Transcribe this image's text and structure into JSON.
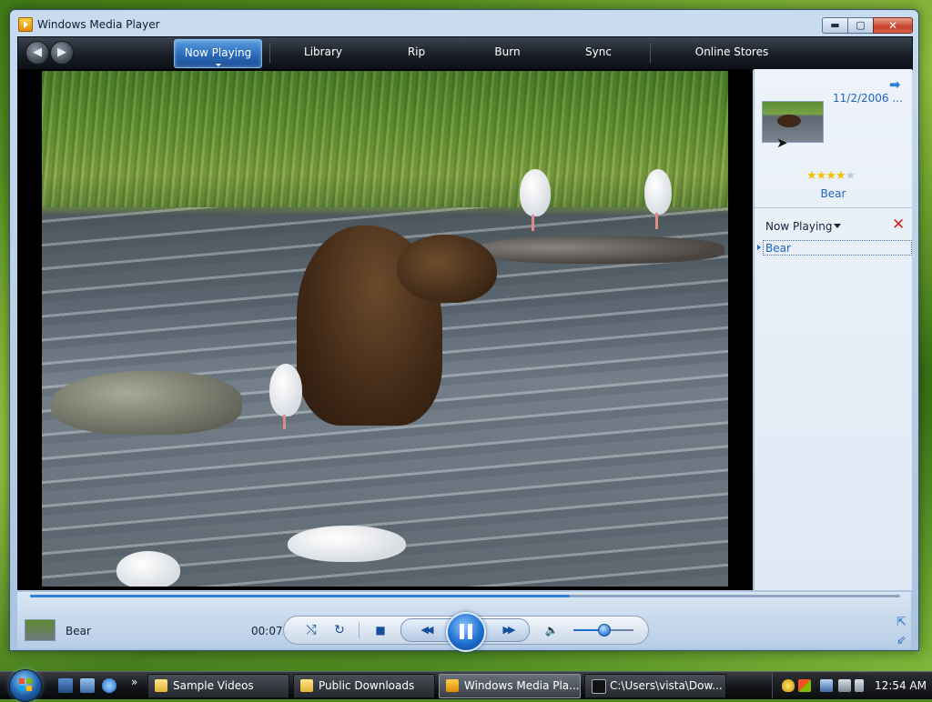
{
  "window": {
    "title": "Windows Media Player",
    "buttons": {
      "minimize": "▬",
      "maximize": "▢",
      "close": "✕"
    }
  },
  "nav": {
    "back_glyph": "◀",
    "forward_glyph": "▶",
    "tabs": [
      {
        "label": "Now Playing",
        "active": true
      },
      {
        "label": "Library",
        "active": false
      },
      {
        "label": "Rip",
        "active": false
      },
      {
        "label": "Burn",
        "active": false
      },
      {
        "label": "Sync",
        "active": false
      },
      {
        "label": "Online Stores",
        "active": false
      }
    ]
  },
  "side_pane": {
    "arrow_glyph": "➡",
    "date": "11/2/2006 ...",
    "rating": 4,
    "rating_max": 5,
    "title": "Bear",
    "list_label": "Now Playing",
    "clear_glyph": "✕",
    "playlist": [
      {
        "label": "Bear"
      }
    ]
  },
  "controls": {
    "title": "Bear",
    "time": "00:07",
    "progress_fraction": 0.62,
    "volume_fraction": 0.5,
    "glyphs": {
      "shuffle": "⤭",
      "repeat": "↻",
      "stop": "■",
      "previous": "◀◀",
      "next": "▶▶",
      "mute": "🔈",
      "switch_to_compact": "⇱",
      "minimize_to_taskbar": "⇙"
    }
  },
  "taskbar": {
    "quicklaunch_chevron": "»",
    "tasks": [
      {
        "label": "Sample Videos",
        "active": false
      },
      {
        "label": "Public Downloads",
        "active": false
      },
      {
        "label": "Windows Media Pla...",
        "active": true
      },
      {
        "label": "C:\\Users\\vista\\Dow...",
        "active": false
      }
    ],
    "clock": "12:54 AM"
  },
  "colors": {
    "accent": "#2064c0",
    "progress": "#2f7fdc",
    "rating_star": "#f2c400",
    "clear_red": "#d3281d"
  }
}
